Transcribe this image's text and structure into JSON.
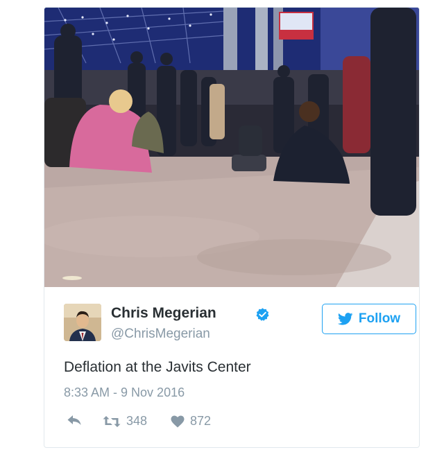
{
  "tweet": {
    "author": {
      "display_name": "Chris Megerian",
      "handle": "@ChrisMegerian",
      "verified": true,
      "avatar_icon": "profile-photo"
    },
    "follow_button": {
      "label": "Follow",
      "icon": "twitter-bird-icon"
    },
    "text": "Deflation at the Javits Center",
    "timestamp": "8:33 AM - 9 Nov 2016",
    "actions": {
      "reply_icon": "reply-icon",
      "retweet_icon": "retweet-icon",
      "retweet_count": "348",
      "like_icon": "heart-icon",
      "like_count": "872"
    },
    "photo": {
      "subject": "photo-of-crowd-at-convention-center"
    }
  },
  "colors": {
    "accent": "#1da1f2",
    "text": "#292f33",
    "secondary_text": "#8899a6",
    "border": "#e1e8ed",
    "verified": "#1da1f2"
  }
}
